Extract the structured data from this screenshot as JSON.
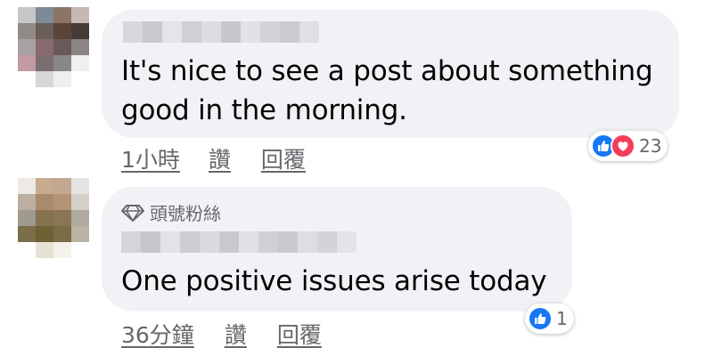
{
  "comments": [
    {
      "text_line1": "It's nice to see a post about something",
      "text_line2": "good in the morning.",
      "time": "1小時",
      "like_label": "讚",
      "reply_label": "回覆",
      "reaction_count": "23",
      "reaction_icons": [
        "like-icon",
        "love-icon"
      ]
    },
    {
      "badge": "頭號粉絲",
      "badge_icon": "diamond-icon",
      "text": "One positive issues arise today",
      "time": "36分鐘",
      "like_label": "讚",
      "reply_label": "回覆",
      "reaction_count": "1",
      "reaction_icons": [
        "like-icon"
      ]
    }
  ],
  "colors": {
    "bubble": "#f0f2f5",
    "meta_text": "#65676b",
    "like_blue": "#1877f2",
    "love_red": "#f33e58"
  }
}
